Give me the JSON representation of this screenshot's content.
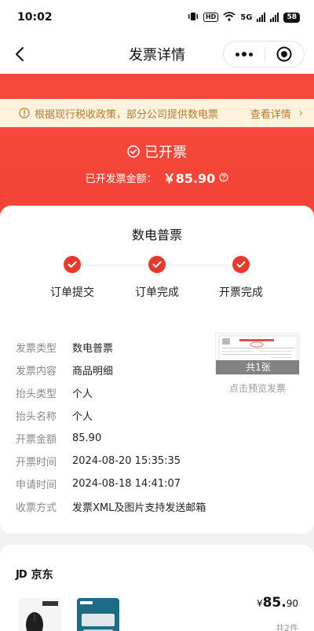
{
  "status_bar": {
    "time": "10:02",
    "network": "5G",
    "battery": "58"
  },
  "navbar": {
    "title": "发票详情",
    "back_icon": "chevron-left-icon",
    "more_icon": "more-dots-icon",
    "close_icon": "target-circle-icon"
  },
  "notice": {
    "text": "根据现行税收政策，部分公司提供数电票",
    "link": "查看详情",
    "arrow": "›"
  },
  "status": {
    "label": "已开票",
    "amount_label": "已开发票金额：",
    "amount": "￥85.90"
  },
  "invoice": {
    "type_title": "数电普票",
    "steps": [
      {
        "label": "订单提交"
      },
      {
        "label": "订单完成"
      },
      {
        "label": "开票完成"
      }
    ],
    "fields": [
      {
        "key": "发票类型",
        "value": "数电普票"
      },
      {
        "key": "发票内容",
        "value": "商品明细"
      },
      {
        "key": "抬头类型",
        "value": "个人"
      },
      {
        "key": "抬头名称",
        "value": "个人"
      },
      {
        "key": "开票金额",
        "value": "85.90"
      },
      {
        "key": "开票时间",
        "value": "2024-08-20 15:35:35"
      },
      {
        "key": "申请时间",
        "value": "2024-08-18 14:41:07"
      },
      {
        "key": "收票方式",
        "value": "发票XML及图片支持发送邮箱"
      }
    ],
    "preview_count": "共1张",
    "preview_hint": "点击预览发票"
  },
  "order": {
    "shop_logo": "JD",
    "shop_name": "京东",
    "price_symbol": "¥",
    "price_int": "85.",
    "price_dec": "90",
    "quantity": "共2件"
  },
  "colors": {
    "brand_red": "#f44236",
    "step_red": "#e53a2f",
    "notice_bg": "#fff3de",
    "notice_text": "#b57a2e"
  }
}
